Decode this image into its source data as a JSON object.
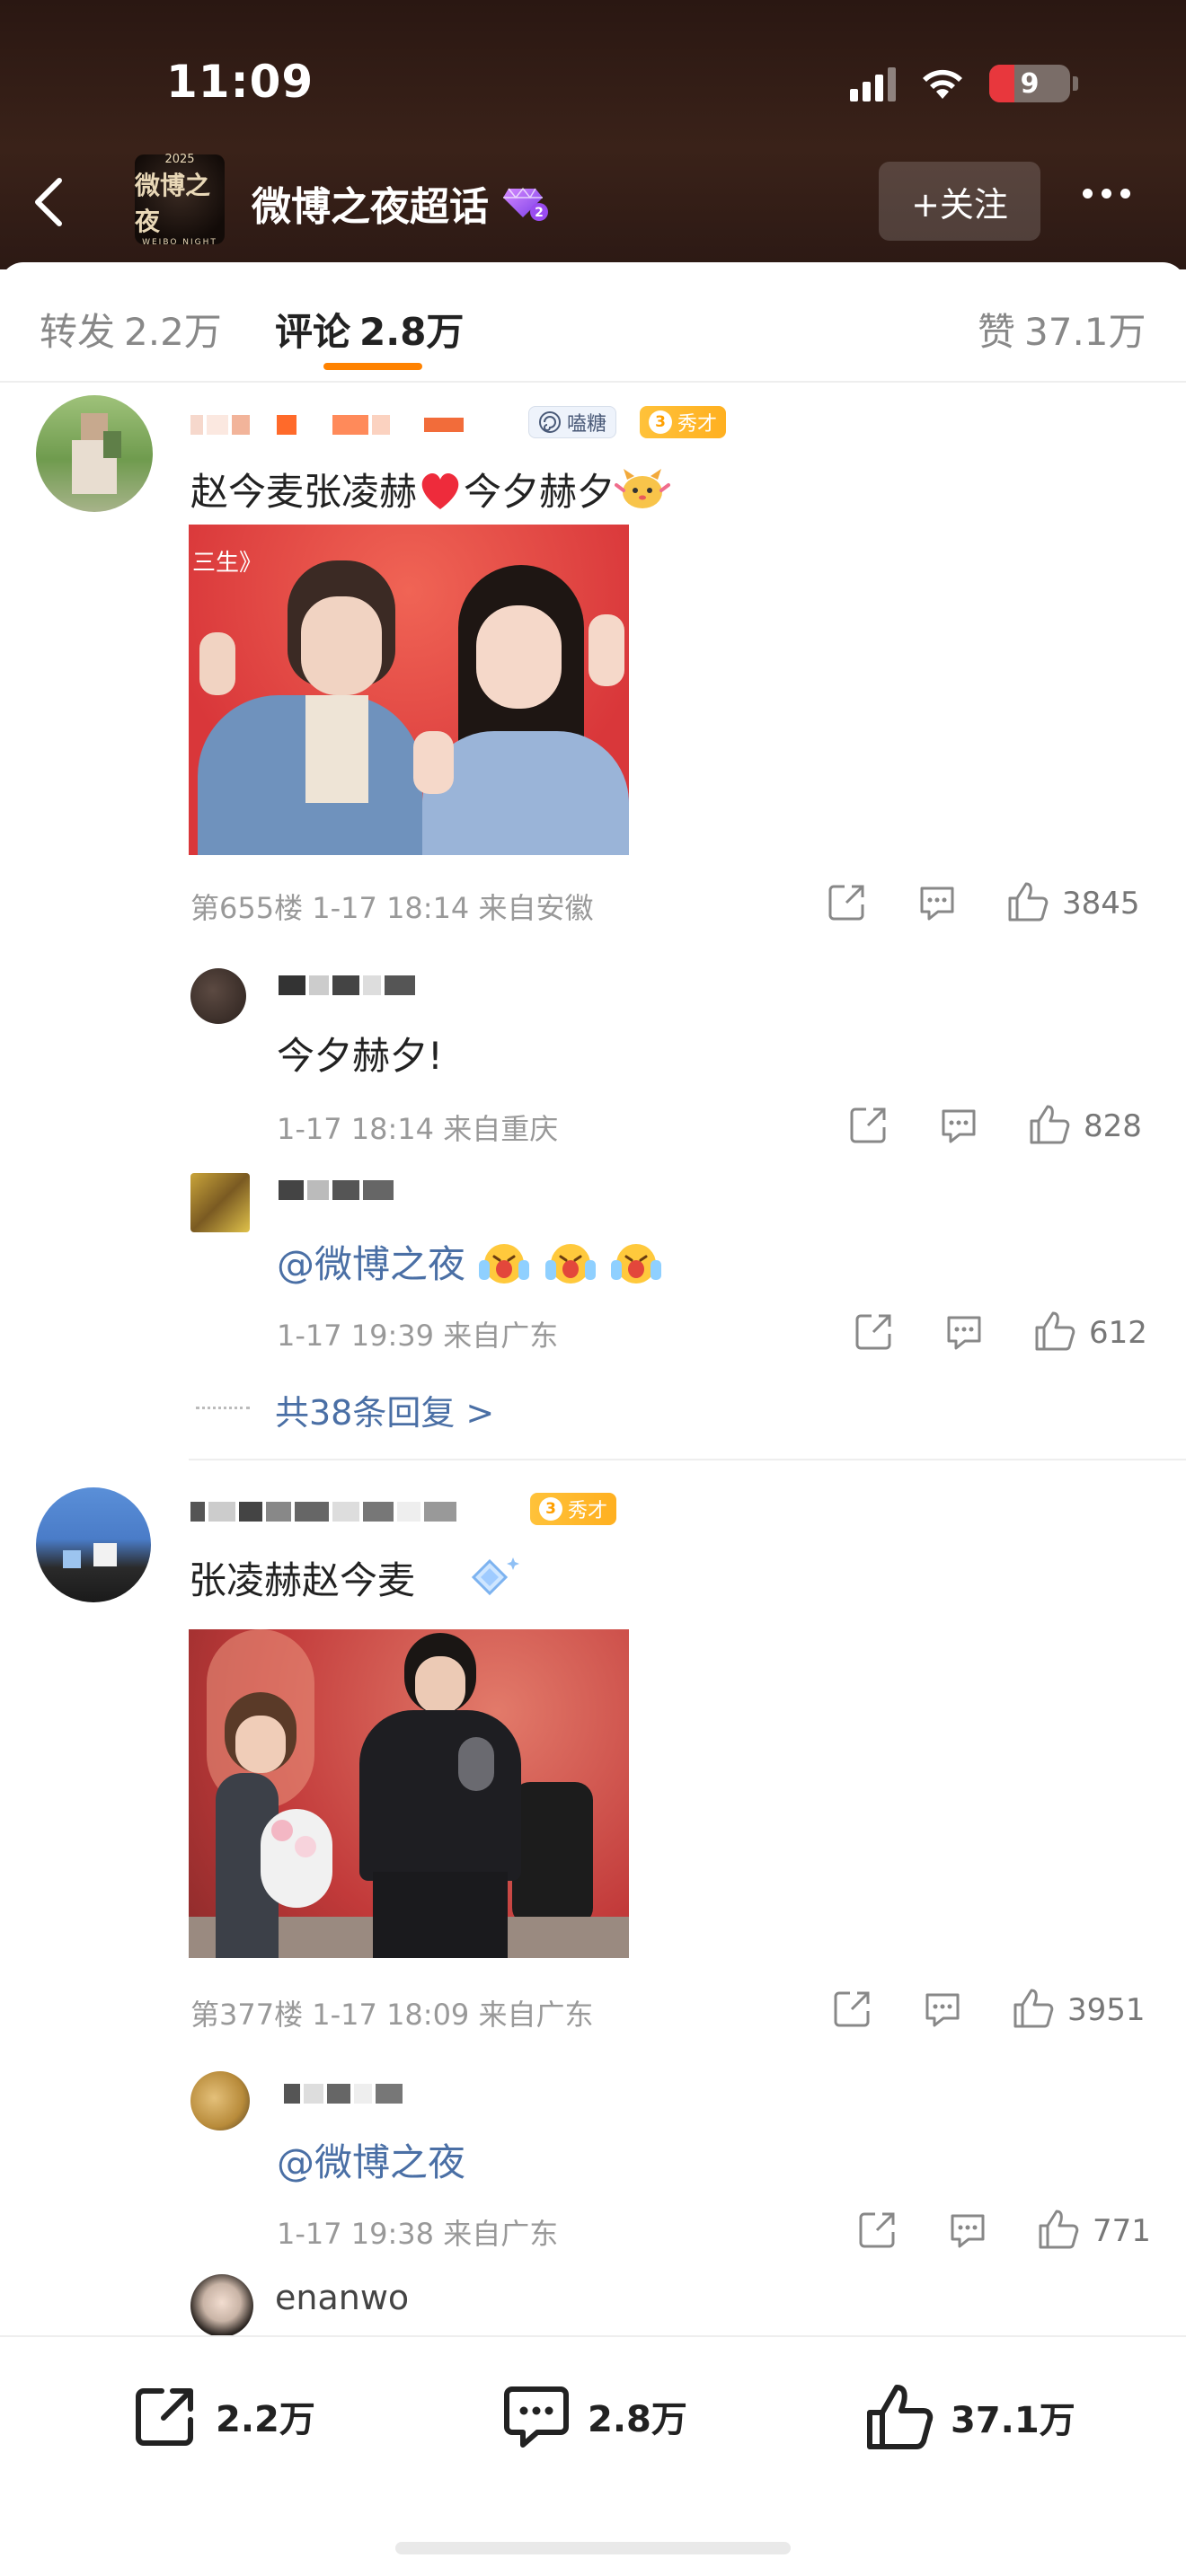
{
  "status_bar": {
    "time": "11:09",
    "battery": "9"
  },
  "header": {
    "topic_logo_lines": [
      "2025",
      "微博之夜",
      "WEIBO NIGHT"
    ],
    "topic_title": "微博之夜超话",
    "follow_label": "+关注"
  },
  "tabs": [
    {
      "label": "转发",
      "value": "2.2万"
    },
    {
      "label": "评论",
      "value": "2.8万"
    },
    {
      "label": "赞",
      "value": "37.1万"
    }
  ],
  "badges": {
    "candy": "嗑糖",
    "talent": "秀才",
    "talent_level": "3"
  },
  "comments": [
    {
      "text": "赵今麦张凌赫",
      "text_after_heart": "今夕赫夕",
      "floor": "第655楼",
      "time": "1-17 18:14",
      "location": "来自安徽",
      "likes": "3845",
      "photo_tag": "三生》",
      "replies": [
        {
          "text": "今夕赫夕!",
          "time": "1-17 18:14",
          "location": "来自重庆",
          "likes": "828"
        },
        {
          "text": "@微博之夜",
          "time": "1-17 19:39",
          "location": "来自广东",
          "likes": "612"
        }
      ],
      "more_replies": "共38条回复 >"
    },
    {
      "text": "张凌赫赵今麦",
      "floor": "第377楼",
      "time": "1-17 18:09",
      "location": "来自广东",
      "likes": "3951",
      "replies": [
        {
          "text": "@微博之夜",
          "time": "1-17 19:38",
          "location": "来自广东",
          "likes": "771"
        }
      ],
      "next_user": "enanwo"
    }
  ],
  "bottom_bar": {
    "repost": "2.2万",
    "comment": "2.8万",
    "like": "37.1万"
  }
}
